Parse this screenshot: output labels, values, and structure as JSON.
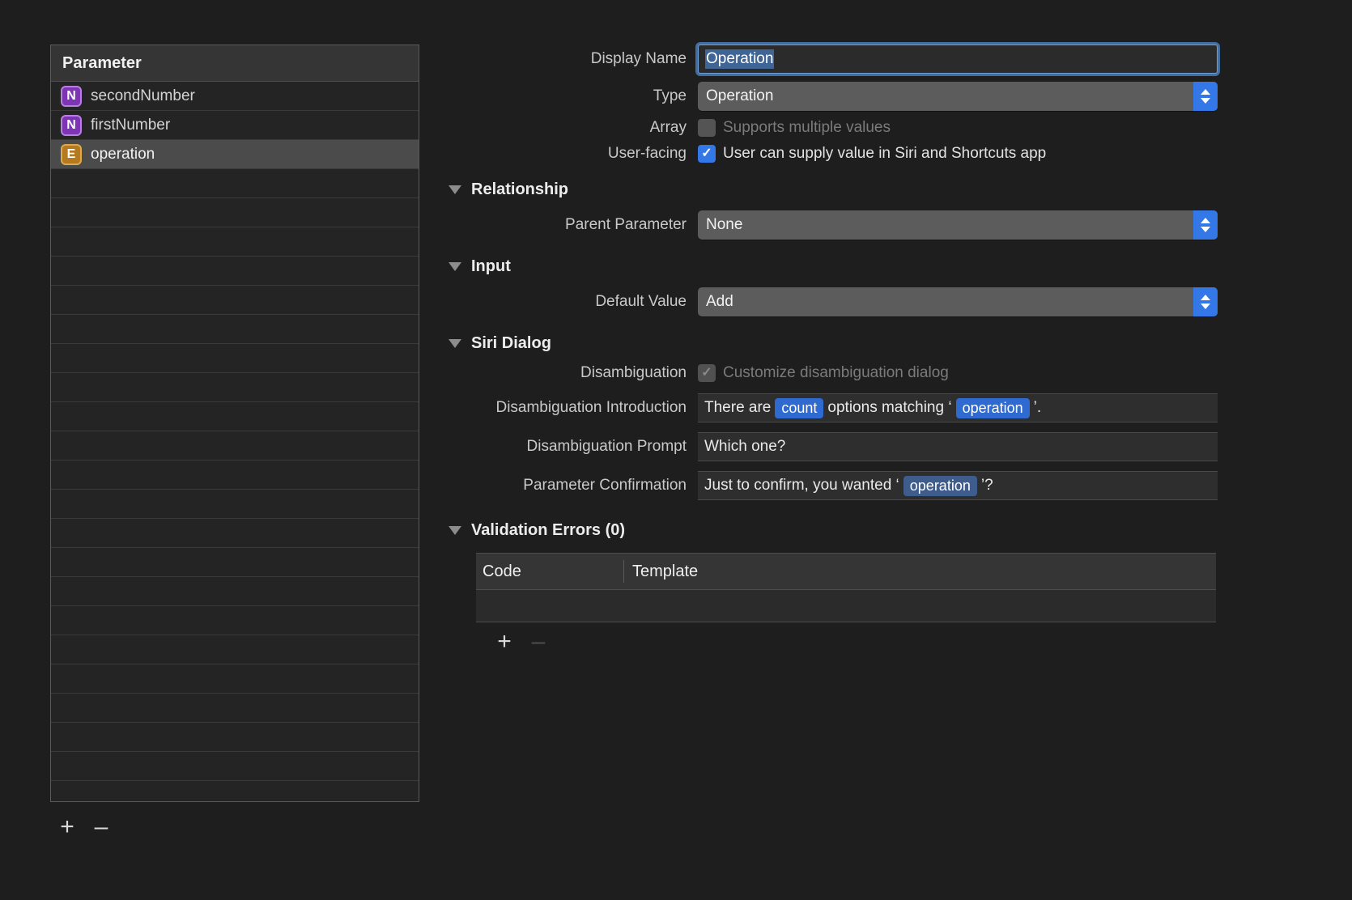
{
  "parameter_list": {
    "header": "Parameter",
    "rows": [
      {
        "badge": "N",
        "badge_kind": "number",
        "label": "secondNumber",
        "selected": false
      },
      {
        "badge": "N",
        "badge_kind": "number",
        "label": "firstNumber",
        "selected": false
      },
      {
        "badge": "E",
        "badge_kind": "enum",
        "label": "operation",
        "selected": true
      }
    ],
    "empty_row_count": 23,
    "add_label": "+",
    "remove_label": "–"
  },
  "inspector": {
    "display_name": {
      "label": "Display Name",
      "value": "Operation",
      "selected": true
    },
    "type": {
      "label": "Type",
      "value": "Operation"
    },
    "array": {
      "label": "Array",
      "checkbox_label": "Supports multiple values",
      "checked": false,
      "enabled": false
    },
    "user_facing": {
      "label": "User-facing",
      "checkbox_label": "User can supply value in Siri and Shortcuts app",
      "checked": true,
      "enabled": true
    },
    "relationship": {
      "section_title": "Relationship",
      "parent_parameter": {
        "label": "Parent Parameter",
        "value": "None"
      }
    },
    "input": {
      "section_title": "Input",
      "default_value": {
        "label": "Default Value",
        "value": "Add"
      }
    },
    "siri_dialog": {
      "section_title": "Siri Dialog",
      "disambiguation": {
        "label": "Disambiguation",
        "checkbox_label": "Customize disambiguation dialog",
        "checked": true,
        "enabled": false
      },
      "disambiguation_introduction": {
        "label": "Disambiguation Introduction",
        "parts": [
          {
            "kind": "text",
            "text": "There are"
          },
          {
            "kind": "token",
            "text": "count",
            "style": "bright"
          },
          {
            "kind": "text",
            "text": "options matching ‘"
          },
          {
            "kind": "token",
            "text": "operation",
            "style": "bright"
          },
          {
            "kind": "text",
            "text": "’."
          }
        ]
      },
      "disambiguation_prompt": {
        "label": "Disambiguation Prompt",
        "value": "Which one?"
      },
      "parameter_confirmation": {
        "label": "Parameter Confirmation",
        "parts": [
          {
            "kind": "text",
            "text": "Just to confirm, you wanted ‘"
          },
          {
            "kind": "token",
            "text": "operation",
            "style": "muted"
          },
          {
            "kind": "text",
            "text": "’?"
          }
        ]
      }
    },
    "validation_errors": {
      "section_title": "Validation Errors (0)",
      "columns": [
        "Code",
        "Template"
      ],
      "rows": [],
      "add_label": "+",
      "remove_label": "–"
    }
  },
  "colors": {
    "window_background": "#1e1e1e",
    "accent_blue": "#3478e8",
    "selection_blue": "#3f6596",
    "badge_number": "#7d35b5",
    "badge_enum": "#b5791f",
    "token_bright": "#2f6ad0",
    "token_muted": "#3f5d8c"
  }
}
